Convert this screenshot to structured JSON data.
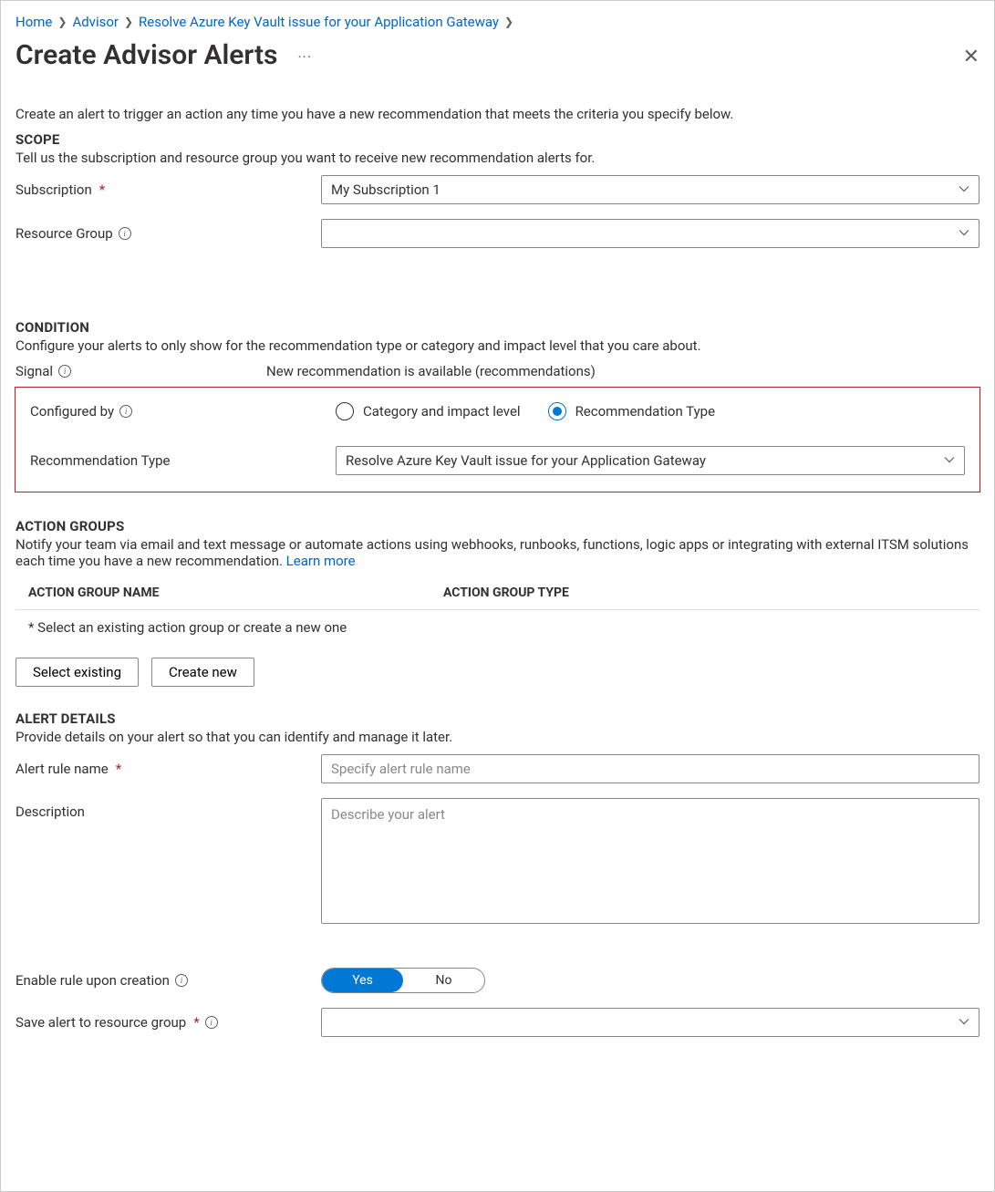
{
  "breadcrumb": {
    "items": [
      {
        "label": "Home"
      },
      {
        "label": "Advisor"
      },
      {
        "label": "Resolve Azure Key Vault issue for your Application Gateway"
      }
    ]
  },
  "title": "Create Advisor Alerts",
  "intro": "Create an alert to trigger an action any time you have a new recommendation that meets the criteria you specify below.",
  "scope": {
    "heading": "SCOPE",
    "desc": "Tell us the subscription and resource group you want to receive new recommendation alerts for.",
    "subscription_label": "Subscription",
    "subscription_value": "My Subscription 1",
    "resource_group_label": "Resource Group",
    "resource_group_value": ""
  },
  "condition": {
    "heading": "CONDITION",
    "desc": "Configure your alerts to only show for the recommendation type or category and impact level that you care about.",
    "signal_label": "Signal",
    "signal_value": "New recommendation is available (recommendations)",
    "configured_by_label": "Configured by",
    "radio_category": "Category and impact level",
    "radio_type": "Recommendation Type",
    "rec_type_label": "Recommendation Type",
    "rec_type_value": "Resolve Azure Key Vault issue for your Application Gateway"
  },
  "action_groups": {
    "heading": "ACTION GROUPS",
    "desc": "Notify your team via email and text message or automate actions using webhooks, runbooks, functions, logic apps or integrating with external ITSM solutions each time you have a new recommendation. ",
    "learn_more": "Learn more",
    "col_name": "ACTION GROUP NAME",
    "col_type": "ACTION GROUP TYPE",
    "placeholder": "* Select an existing action group or create a new one",
    "select_existing": "Select existing",
    "create_new": "Create new"
  },
  "details": {
    "heading": "ALERT DETAILS",
    "desc": "Provide details on your alert so that you can identify and manage it later.",
    "rule_name_label": "Alert rule name",
    "rule_name_placeholder": "Specify alert rule name",
    "description_label": "Description",
    "description_placeholder": "Describe your alert",
    "enable_label": "Enable rule upon creation",
    "enable_yes": "Yes",
    "enable_no": "No",
    "save_rg_label": "Save alert to resource group",
    "save_rg_value": ""
  }
}
